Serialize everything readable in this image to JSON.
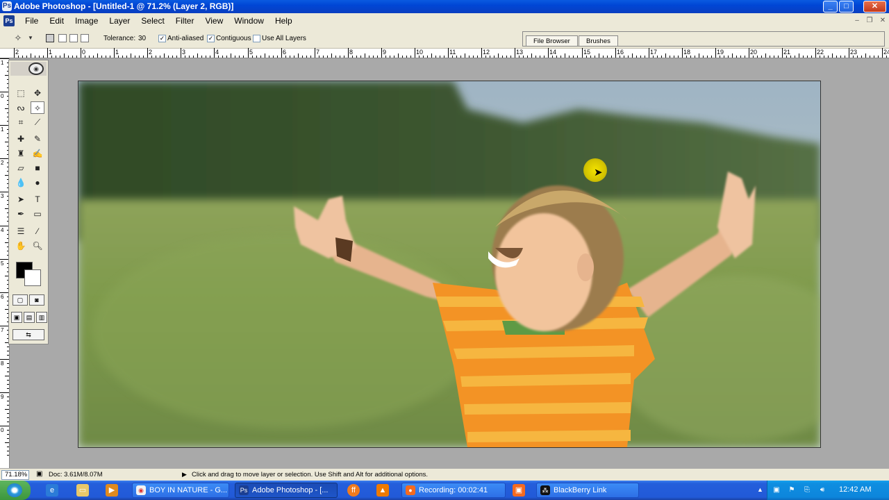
{
  "window": {
    "title": "Adobe Photoshop - [Untitled-1 @ 71.2% (Layer 2, RGB)]",
    "buttons": {
      "minimize": "_",
      "maximize": "□",
      "close": "✕"
    }
  },
  "menu": {
    "items": [
      "File",
      "Edit",
      "Image",
      "Layer",
      "Select",
      "Filter",
      "View",
      "Window",
      "Help"
    ]
  },
  "options": {
    "tolerance_label": "Tolerance:",
    "tolerance_value": "30",
    "anti_aliased_label": "Anti-aliased",
    "anti_aliased_checked": true,
    "contiguous_label": "Contiguous",
    "contiguous_checked": true,
    "use_all_layers_label": "Use All Layers",
    "use_all_layers_checked": false,
    "palette_tabs": [
      "File Browser",
      "Brushes"
    ]
  },
  "ruler": {
    "h_labels": [
      "2",
      "1",
      "0",
      "1",
      "2",
      "3",
      "4",
      "5",
      "6",
      "7",
      "8",
      "9",
      "10",
      "11",
      "12",
      "13",
      "14",
      "15",
      "16",
      "17",
      "18",
      "19",
      "20",
      "21",
      "22",
      "23",
      "24"
    ],
    "v_labels": [
      "1",
      "0",
      "1",
      "2",
      "3",
      "4",
      "5",
      "6",
      "7",
      "8",
      "9",
      "0"
    ]
  },
  "status": {
    "zoom": "71.18%",
    "doc_size": "Doc: 3.61M/8.07M",
    "hint": "Click and drag to move layer or selection.  Use Shift and Alt for additional options."
  },
  "taskbar": {
    "tasks": [
      {
        "label": "BOY IN NATURE - G...",
        "icon": "chrome-icon"
      },
      {
        "label": "Adobe Photoshop - [...",
        "icon": "photoshop-icon",
        "active": true
      },
      {
        "label": "Recording:  00:02:41",
        "icon": "recorder-icon"
      },
      {
        "label": "BlackBerry Link",
        "icon": "blackberry-icon"
      }
    ],
    "clock": "12:42 AM"
  },
  "colors": {
    "foreground": "#000000",
    "background": "#ffffff",
    "taskbar": "#245edb",
    "title_bar": "#0046d5"
  }
}
